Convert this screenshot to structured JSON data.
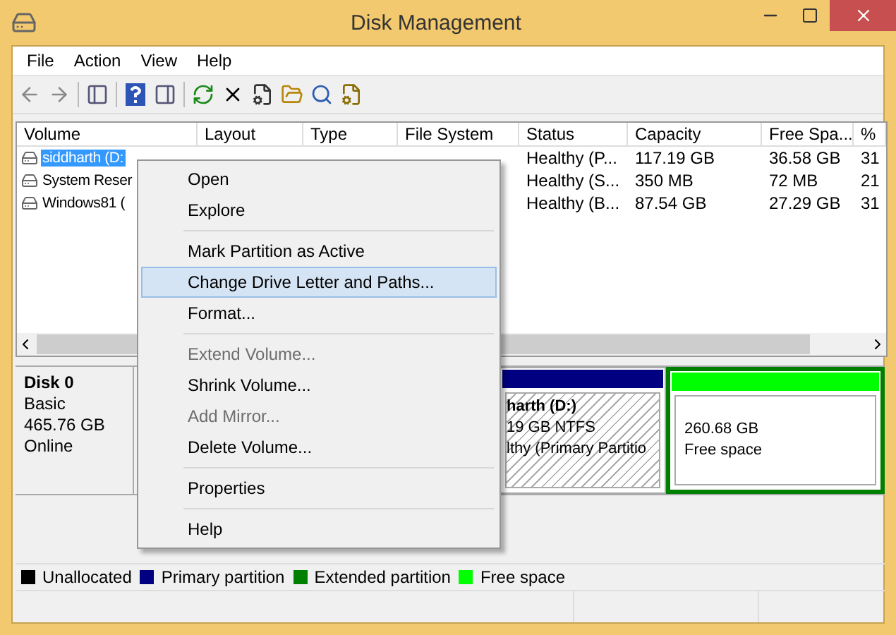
{
  "window": {
    "title": "Disk Management"
  },
  "menu_bar": [
    "File",
    "Action",
    "View",
    "Help"
  ],
  "table": {
    "columns": [
      "Volume",
      "Layout",
      "Type",
      "File System",
      "Status",
      "Capacity",
      "Free Spa...",
      "%"
    ],
    "rows": [
      {
        "volume": "siddharth (D:",
        "status": "Healthy (P...",
        "capacity": "117.19 GB",
        "free_space": "36.58 GB",
        "percent_free": "31",
        "selected": true
      },
      {
        "volume": "System Reser",
        "status": "Healthy (S...",
        "capacity": "350 MB",
        "free_space": "72 MB",
        "percent_free": "21",
        "selected": false
      },
      {
        "volume": "Windows81 (",
        "status": "Healthy (B...",
        "capacity": "87.54 GB",
        "free_space": "27.29 GB",
        "percent_free": "31",
        "selected": false
      }
    ]
  },
  "disk": {
    "name": "Disk 0",
    "type": "Basic",
    "size": "465.76 GB",
    "state": "Online"
  },
  "partitions": [
    {
      "kind": "primary",
      "lines": [
        "harth  (D:)",
        "19 GB NTFS",
        "lthy (Primary Partitio"
      ]
    },
    {
      "kind": "free",
      "lines": [
        "260.68 GB",
        "Free space"
      ]
    }
  ],
  "legend": [
    {
      "label": "Unallocated",
      "color": "#000000"
    },
    {
      "label": "Primary partition",
      "color": "#000080"
    },
    {
      "label": "Extended partition",
      "color": "#008000"
    },
    {
      "label": "Free space",
      "color": "#00ff00"
    }
  ],
  "context_menu": [
    {
      "kind": "item",
      "label": "Open",
      "disabled": false,
      "selected": false
    },
    {
      "kind": "item",
      "label": "Explore",
      "disabled": false,
      "selected": false
    },
    {
      "kind": "separator"
    },
    {
      "kind": "item",
      "label": "Mark Partition as Active",
      "disabled": false,
      "selected": false
    },
    {
      "kind": "item",
      "label": "Change Drive Letter and Paths...",
      "disabled": false,
      "selected": true
    },
    {
      "kind": "item",
      "label": "Format...",
      "disabled": false,
      "selected": false
    },
    {
      "kind": "separator"
    },
    {
      "kind": "item",
      "label": "Extend Volume...",
      "disabled": true,
      "selected": false
    },
    {
      "kind": "item",
      "label": "Shrink Volume...",
      "disabled": false,
      "selected": false
    },
    {
      "kind": "item",
      "label": "Add Mirror...",
      "disabled": true,
      "selected": false
    },
    {
      "kind": "item",
      "label": "Delete Volume...",
      "disabled": false,
      "selected": false
    },
    {
      "kind": "separator"
    },
    {
      "kind": "item",
      "label": "Properties",
      "disabled": false,
      "selected": false
    },
    {
      "kind": "separator"
    },
    {
      "kind": "item",
      "label": "Help",
      "disabled": false,
      "selected": false
    }
  ]
}
